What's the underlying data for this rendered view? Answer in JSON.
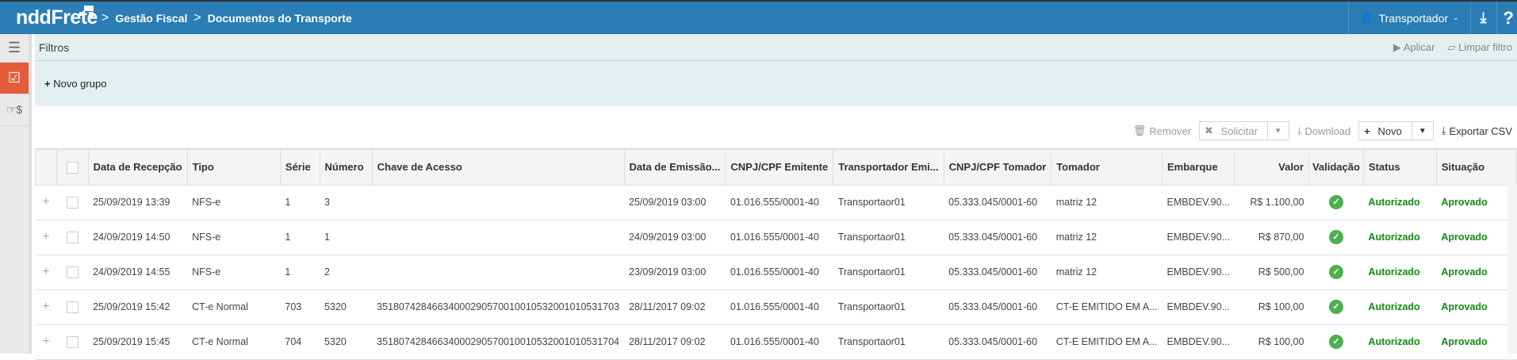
{
  "header": {
    "logo": "nddFrete",
    "breadcrumbs": [
      "Gestão Fiscal",
      "Documentos do Transporte"
    ],
    "user": "Transportador",
    "help": "?"
  },
  "colors": {
    "topbar": "#2a7db5",
    "active_sidebar": "#e35d3c",
    "filter_bg": "#e4eff1",
    "success": "#4caf50"
  },
  "filters": {
    "title": "Filtros",
    "apply": "Aplicar",
    "clear": "Limpar filtro",
    "new_group": "Novo grupo"
  },
  "toolbar": {
    "remove": "Remover",
    "request": "Solicitar",
    "download": "Download",
    "new": "Novo",
    "export": "Exportar CSV"
  },
  "table": {
    "columns": [
      "Data de Recepção",
      "Tipo",
      "Série",
      "Número",
      "Chave de Acesso",
      "Data de Emissão...",
      "CNPJ/CPF Emitente",
      "Transportador Emi...",
      "CNPJ/CPF Tomador",
      "Tomador",
      "Embarque",
      "Valor",
      "Validação",
      "Status",
      "Situação"
    ],
    "rows": [
      [
        "25/09/2019 13:39",
        "NFS-e",
        "1",
        "3",
        "",
        "25/09/2019 03:00",
        "01.016.555/0001-40",
        "Transportaor01",
        "05.333.045/0001-60",
        "matriz 12",
        "EMBDEV.90...",
        "R$ 1.100,00",
        "ok",
        "Autorizado",
        "Aprovado"
      ],
      [
        "24/09/2019 14:50",
        "NFS-e",
        "1",
        "1",
        "",
        "24/09/2019 03:00",
        "01.016.555/0001-40",
        "Transportaor01",
        "05.333.045/0001-60",
        "matriz 12",
        "EMBDEV.90...",
        "R$ 870,00",
        "ok",
        "Autorizado",
        "Aprovado"
      ],
      [
        "24/09/2019 14:55",
        "NFS-e",
        "1",
        "2",
        "",
        "23/09/2019 03:00",
        "01.016.555/0001-40",
        "Transportaor01",
        "05.333.045/0001-60",
        "matriz 12",
        "EMBDEV.90...",
        "R$ 500,00",
        "ok",
        "Autorizado",
        "Aprovado"
      ],
      [
        "25/09/2019 15:42",
        "CT-e Normal",
        "703",
        "5320",
        "35180742846634000290570010010532001010531703",
        "28/11/2017 09:02",
        "01.016.555/0001-40",
        "Transportaor01",
        "05.333.045/0001-60",
        "CT-E EMITIDO EM A...",
        "EMBDEV.90...",
        "R$ 100,00",
        "ok",
        "Autorizado",
        "Aprovado"
      ],
      [
        "25/09/2019 15:45",
        "CT-e Normal",
        "704",
        "5320",
        "35180742846634000290570010010532001010531704",
        "28/11/2017 09:02",
        "01.016.555/0001-40",
        "Transportaor01",
        "05.333.045/0001-60",
        "CT-E EMITIDO EM A...",
        "EMBDEV.90...",
        "R$ 100,00",
        "ok",
        "Autorizado",
        "Aprovado"
      ]
    ]
  }
}
